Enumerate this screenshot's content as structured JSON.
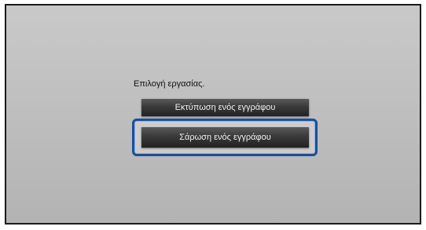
{
  "screen": {
    "prompt": "Επιλογή εργασίας.",
    "options": [
      {
        "label": "Εκτύπωση ενός εγγράφου",
        "selected": false
      },
      {
        "label": "Σάρωση ενός εγγράφου",
        "selected": true
      }
    ]
  },
  "colors": {
    "background": "#bdbdbd",
    "button": "#2e2e2e",
    "button_text": "#f2f2f2",
    "selection": "#1b4f9c"
  }
}
